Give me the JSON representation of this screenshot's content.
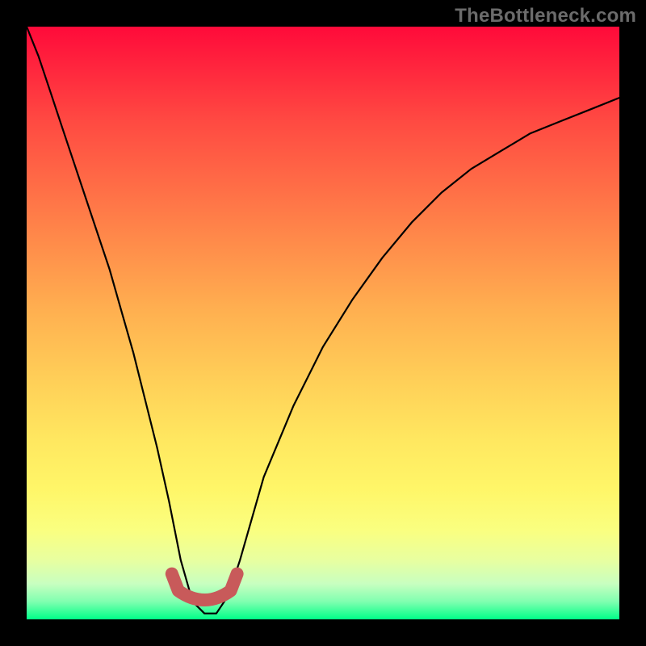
{
  "watermark": "TheBottleneck.com",
  "colors": {
    "background": "#000000",
    "curve_stroke": "#000000",
    "vertex_stroke": "#c85a5a"
  },
  "chart_data": {
    "type": "line",
    "title": "",
    "xlabel": "",
    "ylabel": "",
    "xlim": [
      0,
      100
    ],
    "ylim": [
      0,
      100
    ],
    "grid": false,
    "legend": false,
    "x": [
      0,
      2,
      4,
      6,
      8,
      10,
      12,
      14,
      16,
      18,
      20,
      22,
      24,
      26,
      28,
      30,
      32,
      34,
      36,
      38,
      40,
      45,
      50,
      55,
      60,
      65,
      70,
      75,
      80,
      85,
      90,
      95,
      100
    ],
    "values": [
      100,
      95,
      89,
      83,
      77,
      71,
      65,
      59,
      52,
      45,
      37,
      29,
      20,
      10,
      3,
      1,
      1,
      4,
      10,
      17,
      24,
      36,
      46,
      54,
      61,
      67,
      72,
      76,
      79,
      82,
      84,
      86,
      88
    ],
    "vertex_highlight": {
      "x_range": [
        24.5,
        35.5
      ],
      "y_level_approx": 2.5,
      "style": "thick-rounded-pink"
    },
    "notes": "Asymmetric V-shaped curve on a vertical rainbow gradient (red top → green bottom). Vertex near x≈30 is emphasized with a thick rounded pink U-shaped stroke."
  }
}
